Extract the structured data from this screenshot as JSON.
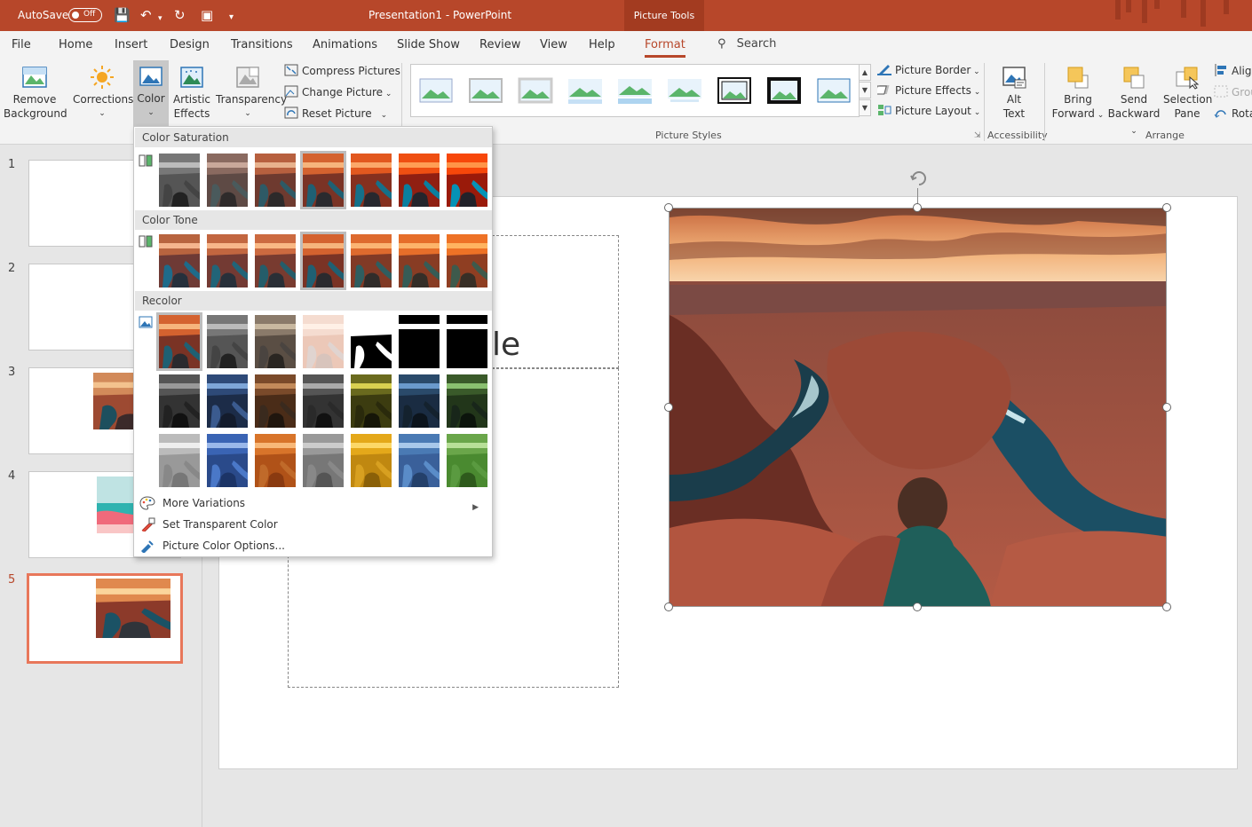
{
  "titlebar": {
    "autosave_label": "AutoSave",
    "autosave_state": "Off",
    "doc_title": "Presentation1  -  PowerPoint",
    "context_tab": "Picture Tools"
  },
  "tabs": [
    {
      "label": "File"
    },
    {
      "label": "Home"
    },
    {
      "label": "Insert"
    },
    {
      "label": "Design"
    },
    {
      "label": "Transitions"
    },
    {
      "label": "Animations"
    },
    {
      "label": "Slide Show"
    },
    {
      "label": "Review"
    },
    {
      "label": "View"
    },
    {
      "label": "Help"
    },
    {
      "label": "Format"
    }
  ],
  "search_label": "Search",
  "ribbon": {
    "remove_bg": [
      "Remove",
      "Background"
    ],
    "corrections": "Corrections",
    "color": "Color",
    "artistic": [
      "Artistic",
      "Effects"
    ],
    "transparency": "Transparency",
    "compress": "Compress Pictures",
    "change_picture": "Change Picture",
    "reset_picture": "Reset Picture",
    "picture_styles_label": "Picture Styles",
    "picture_border": "Picture Border",
    "picture_effects": "Picture Effects",
    "picture_layout": "Picture Layout",
    "alt_text": [
      "Alt",
      "Text"
    ],
    "accessibility_label": "Accessibility",
    "bring_forward": [
      "Bring",
      "Forward"
    ],
    "send_backward": [
      "Send",
      "Backward"
    ],
    "selection_pane": [
      "Selection",
      "Pane"
    ],
    "align": "Align",
    "group": "Group",
    "rotate": "Rotate",
    "arrange_label": "Arrange"
  },
  "slides": [
    {
      "num": "1"
    },
    {
      "num": "2"
    },
    {
      "num": "3"
    },
    {
      "num": "4"
    },
    {
      "num": "5"
    }
  ],
  "slide_text_fragment": "le",
  "dropdown": {
    "saturation_title": "Color Saturation",
    "tone_title": "Color Tone",
    "recolor_title": "Recolor",
    "more_variations": "More Variations",
    "set_transparent": "Set Transparent Color",
    "color_options": "Picture Color Options..."
  },
  "colors": {
    "accent": "#b7472a",
    "selected_thumb_border": "#e8775a"
  }
}
